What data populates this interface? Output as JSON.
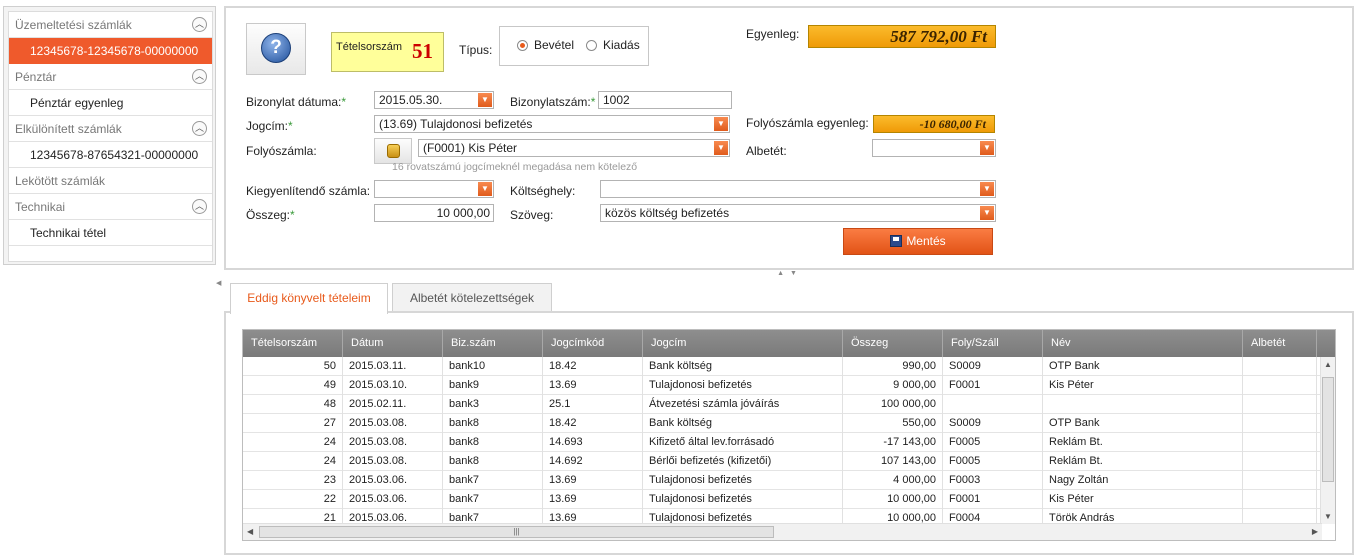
{
  "sidebar": {
    "sections": [
      {
        "title": "Üzemeltetési számlák",
        "collapsible": true,
        "items": [
          "12345678-12345678-00000000"
        ]
      },
      {
        "title": "Pénztár",
        "collapsible": true,
        "items": [
          "Pénztár egyenleg"
        ]
      },
      {
        "title": "Elkülönített számlák",
        "collapsible": true,
        "items": [
          "12345678-87654321-00000000"
        ]
      },
      {
        "title": "Lekötött számlák",
        "collapsible": false,
        "items": []
      },
      {
        "title": "Technikai",
        "collapsible": true,
        "items": [
          "Technikai tétel"
        ]
      }
    ],
    "active_item": "12345678-12345678-00000000"
  },
  "form": {
    "tetel_label": "Tételsorszám",
    "tetel_num": "51",
    "tipus_label": "Típus:",
    "bevetel_label": "Bevétel",
    "kiadas_label": "Kiadás",
    "tipus_selected": "Bevétel",
    "egyenleg_label": "Egyenleg:",
    "egyenleg_value": "587 792,00 Ft",
    "datum_label": "Bizonylat dátuma:",
    "datum_value": "2015.05.30.",
    "bizszam_label": "Bizonylatszám:",
    "bizszam_value": "1002",
    "jogcim_label": "Jogcím:",
    "jogcim_value": "(13.69) Tulajdonosi befizetés",
    "folyo_egyenleg_label": "Folyószámla egyenleg:",
    "folyo_egyenleg_value": "-10 680,00 Ft",
    "folyoszamla_label": "Folyószámla:",
    "folyoszamla_value": "(F0001) Kis Péter",
    "albetet_label": "Albetét:",
    "albetet_value": "",
    "hint": "16 rovatszámú jogcímeknél megadása nem kötelező",
    "kiegy_label": "Kiegyenlítendő számla:",
    "kiegy_value": "",
    "koltseghely_label": "Költséghely:",
    "koltseghely_value": "",
    "osszeg_label": "Összeg:",
    "osszeg_value": "10 000,00",
    "szoveg_label": "Szöveg:",
    "szoveg_value": "közös költség befizetés",
    "save_label": "Mentés",
    "required_mark": "*"
  },
  "tabs": [
    {
      "label": "Eddig könyvelt tételeim",
      "active": true
    },
    {
      "label": "Albetét kötelezettségek",
      "active": false
    }
  ],
  "grid": {
    "columns": [
      "Tételsorszám",
      "Dátum",
      "Biz.szám",
      "Jogcímkód",
      "Jogcím",
      "Összeg",
      "Foly/Száll",
      "Név",
      "Albetét"
    ],
    "rows": [
      [
        "50",
        "2015.03.11.",
        "bank10",
        "18.42",
        "Bank költség",
        "990,00",
        "S0009",
        "OTP Bank",
        ""
      ],
      [
        "49",
        "2015.03.10.",
        "bank9",
        "13.69",
        "Tulajdonosi befizetés",
        "9 000,00",
        "F0001",
        "Kis Péter",
        ""
      ],
      [
        "48",
        "2015.02.11.",
        "bank3",
        "25.1",
        "Átvezetési számla jóváírás",
        "100 000,00",
        "",
        "",
        ""
      ],
      [
        "27",
        "2015.03.08.",
        "bank8",
        "18.42",
        "Bank költség",
        "550,00",
        "S0009",
        "OTP Bank",
        ""
      ],
      [
        "24",
        "2015.03.08.",
        "bank8",
        "14.693",
        "Kifizető által lev.forrásadó",
        "-17 143,00",
        "F0005",
        "Reklám Bt.",
        ""
      ],
      [
        "24",
        "2015.03.08.",
        "bank8",
        "14.692",
        "Bérlői befizetés (kifizetői)",
        "107 143,00",
        "F0005",
        "Reklám Bt.",
        ""
      ],
      [
        "23",
        "2015.03.06.",
        "bank7",
        "13.69",
        "Tulajdonosi befizetés",
        "4 000,00",
        "F0003",
        "Nagy Zoltán",
        ""
      ],
      [
        "22",
        "2015.03.06.",
        "bank7",
        "13.69",
        "Tulajdonosi befizetés",
        "10 000,00",
        "F0001",
        "Kis Péter",
        ""
      ],
      [
        "21",
        "2015.03.06.",
        "bank7",
        "13.69",
        "Tulajdonosi befizetés",
        "10 000,00",
        "F0004",
        "Török András",
        ""
      ]
    ]
  },
  "icons": {
    "help": "question-icon",
    "collapse": "chevron-up-icon",
    "dropdown": "dropdown-arrow-icon",
    "picker": "coins-icon",
    "save": "floppy-disk-icon"
  },
  "colors": {
    "accent": "#ef5a2c",
    "balance": "#f4a418",
    "tetel_bg": "#ffff9a",
    "tetel_num": "#cc0000",
    "grid_header": "#858585"
  }
}
